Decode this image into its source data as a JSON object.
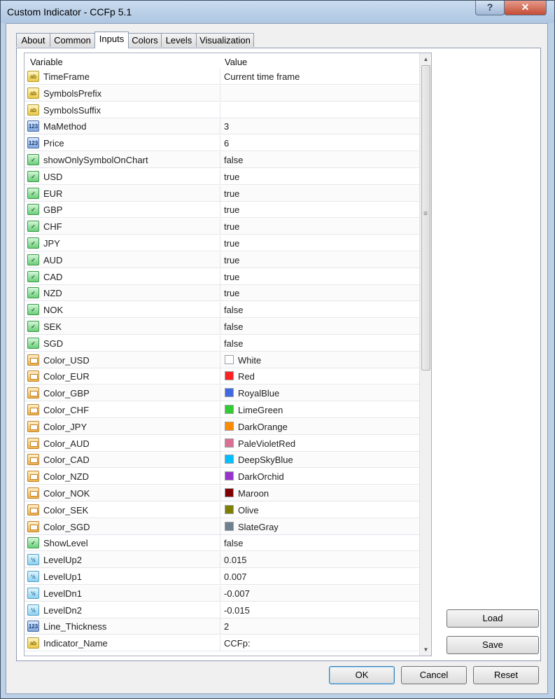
{
  "window": {
    "title": "Custom Indicator - CCFp 5.1",
    "help_glyph": "?",
    "close_glyph": "✕"
  },
  "tabs": [
    "About",
    "Common",
    "Inputs",
    "Colors",
    "Levels",
    "Visualization"
  ],
  "active_tab": "Inputs",
  "grid": {
    "columns": {
      "variable": "Variable",
      "value": "Value"
    },
    "rows": [
      {
        "type": "string",
        "icon": "ab",
        "name": "TimeFrame",
        "value": "Current time frame"
      },
      {
        "type": "string",
        "icon": "ab",
        "name": "SymbolsPrefix",
        "value": ""
      },
      {
        "type": "string",
        "icon": "ab",
        "name": "SymbolsSuffix",
        "value": ""
      },
      {
        "type": "int",
        "icon": "123",
        "name": "MaMethod",
        "value": "3"
      },
      {
        "type": "int",
        "icon": "123",
        "name": "Price",
        "value": "6"
      },
      {
        "type": "bool",
        "icon": "bool",
        "name": "showOnlySymbolOnChart",
        "value": "false"
      },
      {
        "type": "bool",
        "icon": "bool",
        "name": "USD",
        "value": "true"
      },
      {
        "type": "bool",
        "icon": "bool",
        "name": "EUR",
        "value": "true"
      },
      {
        "type": "bool",
        "icon": "bool",
        "name": "GBP",
        "value": "true"
      },
      {
        "type": "bool",
        "icon": "bool",
        "name": "CHF",
        "value": "true"
      },
      {
        "type": "bool",
        "icon": "bool",
        "name": "JPY",
        "value": "true"
      },
      {
        "type": "bool",
        "icon": "bool",
        "name": "AUD",
        "value": "true"
      },
      {
        "type": "bool",
        "icon": "bool",
        "name": "CAD",
        "value": "true"
      },
      {
        "type": "bool",
        "icon": "bool",
        "name": "NZD",
        "value": "true"
      },
      {
        "type": "bool",
        "icon": "bool",
        "name": "NOK",
        "value": "false"
      },
      {
        "type": "bool",
        "icon": "bool",
        "name": "SEK",
        "value": "false"
      },
      {
        "type": "bool",
        "icon": "bool",
        "name": "SGD",
        "value": "false"
      },
      {
        "type": "color",
        "icon": "color",
        "name": "Color_USD",
        "value": "White",
        "swatch": "#ffffff"
      },
      {
        "type": "color",
        "icon": "color",
        "name": "Color_EUR",
        "value": "Red",
        "swatch": "#ff2020"
      },
      {
        "type": "color",
        "icon": "color",
        "name": "Color_GBP",
        "value": "RoyalBlue",
        "swatch": "#4169e1"
      },
      {
        "type": "color",
        "icon": "color",
        "name": "Color_CHF",
        "value": "LimeGreen",
        "swatch": "#32cd32"
      },
      {
        "type": "color",
        "icon": "color",
        "name": "Color_JPY",
        "value": "DarkOrange",
        "swatch": "#ff8c00"
      },
      {
        "type": "color",
        "icon": "color",
        "name": "Color_AUD",
        "value": "PaleVioletRed",
        "swatch": "#db7093"
      },
      {
        "type": "color",
        "icon": "color",
        "name": "Color_CAD",
        "value": "DeepSkyBlue",
        "swatch": "#00bfff"
      },
      {
        "type": "color",
        "icon": "color",
        "name": "Color_NZD",
        "value": "DarkOrchid",
        "swatch": "#9932cc"
      },
      {
        "type": "color",
        "icon": "color",
        "name": "Color_NOK",
        "value": "Maroon",
        "swatch": "#800000"
      },
      {
        "type": "color",
        "icon": "color",
        "name": "Color_SEK",
        "value": "Olive",
        "swatch": "#808000"
      },
      {
        "type": "color",
        "icon": "color",
        "name": "Color_SGD",
        "value": "SlateGray",
        "swatch": "#708090"
      },
      {
        "type": "bool",
        "icon": "bool",
        "name": "ShowLevel",
        "value": "false"
      },
      {
        "type": "double",
        "icon": "v2",
        "name": "LevelUp2",
        "value": "0.015"
      },
      {
        "type": "double",
        "icon": "v2",
        "name": "LevelUp1",
        "value": "0.007"
      },
      {
        "type": "double",
        "icon": "v2",
        "name": "LevelDn1",
        "value": "-0.007"
      },
      {
        "type": "double",
        "icon": "v2",
        "name": "LevelDn2",
        "value": "-0.015"
      },
      {
        "type": "int",
        "icon": "123",
        "name": "Line_Thickness",
        "value": "2"
      },
      {
        "type": "string",
        "icon": "ab",
        "name": "Indicator_Name",
        "value": "CCFp:"
      }
    ]
  },
  "buttons": {
    "load": "Load",
    "save": "Save",
    "ok": "OK",
    "cancel": "Cancel",
    "reset": "Reset"
  }
}
